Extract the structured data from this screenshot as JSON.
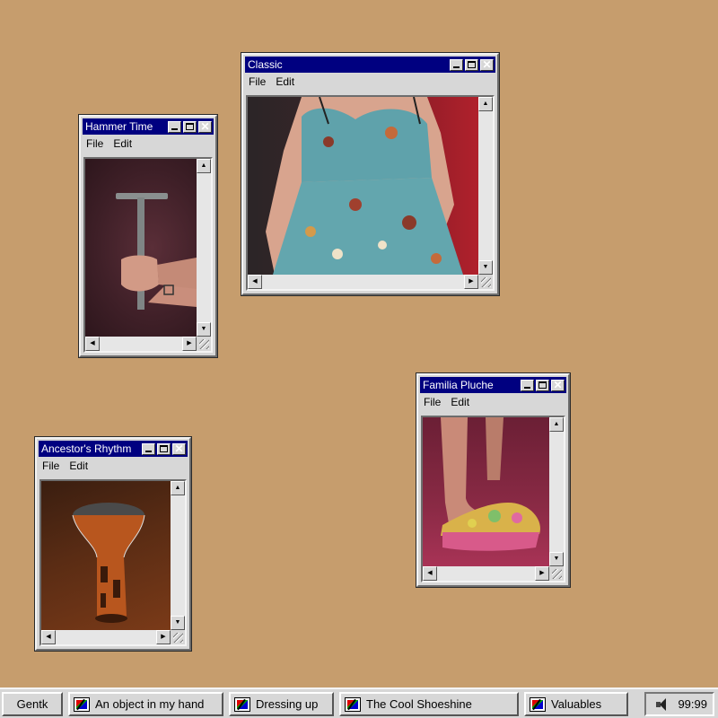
{
  "colors": {
    "desktop": "#c69d6d",
    "titlebar": "#000080",
    "chrome": "#d7d7d7"
  },
  "windows": [
    {
      "id": "hammer-time",
      "title": "Hammer Time",
      "menu": [
        "File",
        "Edit"
      ],
      "photo_icon": "hand-with-hammer-photo"
    },
    {
      "id": "classic",
      "title": "Classic",
      "menu": [
        "File",
        "Edit"
      ],
      "photo_icon": "floral-dress-photo"
    },
    {
      "id": "familia-pluche",
      "title": "Familia Pluche",
      "menu": [
        "File",
        "Edit"
      ],
      "photo_icon": "slide-sandal-photo"
    },
    {
      "id": "ancestors-rhythm",
      "title": "Ancestor's Rhythm",
      "menu": [
        "File",
        "Edit"
      ],
      "photo_icon": "drum-photo"
    }
  ],
  "taskbar": {
    "start_label": "Gentk",
    "buttons": [
      "An object in my hand",
      "Dressing up",
      "The Cool Shoeshine",
      "Valuables"
    ],
    "clock": "99:99",
    "tray_icon": "speaker-icon"
  }
}
